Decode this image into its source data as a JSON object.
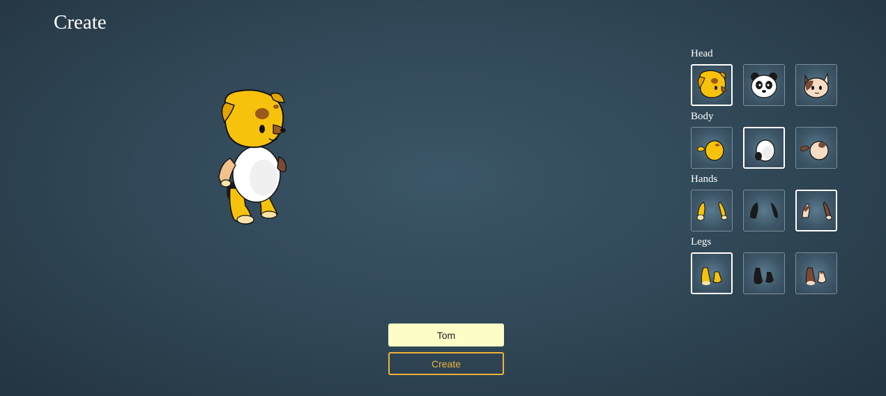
{
  "page": {
    "title": "Create"
  },
  "sections": [
    {
      "label": "Head",
      "selected_index": 0,
      "options": [
        "dog-head-icon",
        "panda-head-icon",
        "cat-head-icon"
      ]
    },
    {
      "label": "Body",
      "selected_index": 1,
      "options": [
        "dog-body-icon",
        "panda-body-icon",
        "cat-body-icon"
      ]
    },
    {
      "label": "Hands",
      "selected_index": 2,
      "options": [
        "dog-hands-icon",
        "panda-hands-icon",
        "cat-hands-icon"
      ]
    },
    {
      "label": "Legs",
      "selected_index": 0,
      "options": [
        "dog-legs-icon",
        "panda-legs-icon",
        "cat-legs-icon"
      ]
    }
  ],
  "name_input": {
    "value": "Tom"
  },
  "create_button": {
    "label": "Create"
  },
  "colors": {
    "accent": "#f0b33a",
    "input_bg": "#fdfdc6",
    "dog_yellow": "#f7c20c",
    "cat_brown": "#7a4a33",
    "panda_black": "#1a1a1a"
  }
}
